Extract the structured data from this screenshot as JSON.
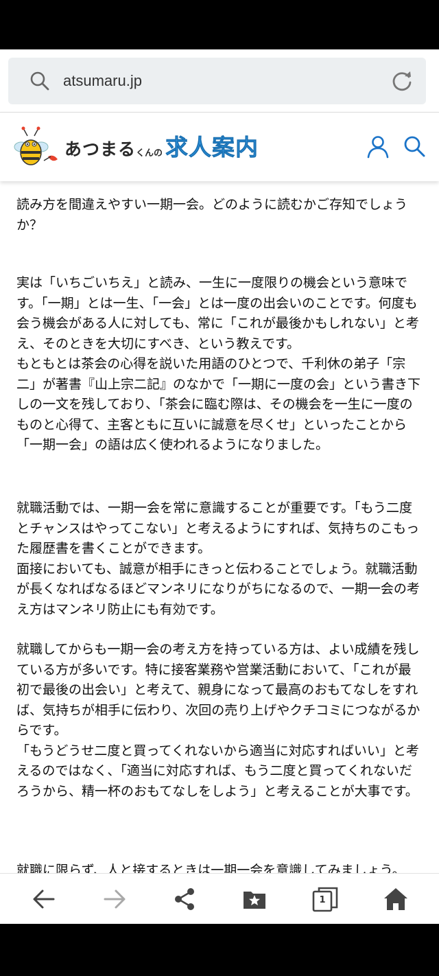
{
  "browser": {
    "url": "atsumaru.jp",
    "tab_count": "1"
  },
  "header": {
    "logo_text_small": "あつまる",
    "logo_text_mini": "くんの",
    "logo_text_big": "求人案内"
  },
  "article": {
    "paragraphs": [
      "読み方を間違えやすい一期一会。どのように読むかご存知でしょうか？",
      "実は「いちごいちえ」と読み、一生に一度限りの機会という意味です。「一期」とは一生、「一会」とは一度の出会いのことです。何度も会う機会がある人に対しても、常に「これが最後かもしれない」と考え、そのときを大切にすべき、という教えです。\nもともとは茶会の心得を説いた用語のひとつで、千利休の弟子「宗二」が著書『山上宗二記』のなかで「一期に一度の会」という書き下しの一文を残しており、「茶会に臨む際は、その機会を一生に一度のものと心得て、主客ともに互いに誠意を尽くせ」といったことから「一期一会」の語は広く使われるようになりました。",
      "就職活動では、一期一会を常に意識することが重要です。「もう二度とチャンスはやってこない」と考えるようにすれば、気持ちのこもった履歴書を書くことができます。\n面接においても、誠意が相手にきっと伝わることでしょう。就職活動が長くなればなるほどマンネリになりがちになるので、一期一会の考え方はマンネリ防止にも有効です。",
      "就職してからも一期一会の考え方を持っている方は、よい成績を残している方が多いです。特に接客業務や営業活動において、「これが最初で最後の出会い」と考えて、親身になって最高のおもてなしをすれば、気持ちが相手に伝わり、次回の売り上げやクチコミにつながるからです。\n「もうどうせ二度と買ってくれないから適当に対応すればいい」と考えるのではなく、「適当に対応すれば、もう二度と買ってくれないだろうから、精一杯のおもてなしをしよう」と考えることが大事です。",
      "就職に限らず、人と接するときは一期一会を意識してみましょう。"
    ]
  },
  "icons": {
    "url_search": "search-icon",
    "reload": "reload-icon",
    "user": "user-icon",
    "header_search": "search-icon",
    "back": "arrow-left-icon",
    "forward": "arrow-right-icon",
    "share": "share-icon",
    "bookmark": "bookmark-star-icon",
    "tabs": "tabs-icon",
    "home": "home-icon"
  },
  "colors": {
    "brand_blue": "#2c8fd8",
    "icon_blue": "#1a73c8",
    "nav_icon": "#444444",
    "nav_icon_disabled": "#a8a8a8"
  }
}
